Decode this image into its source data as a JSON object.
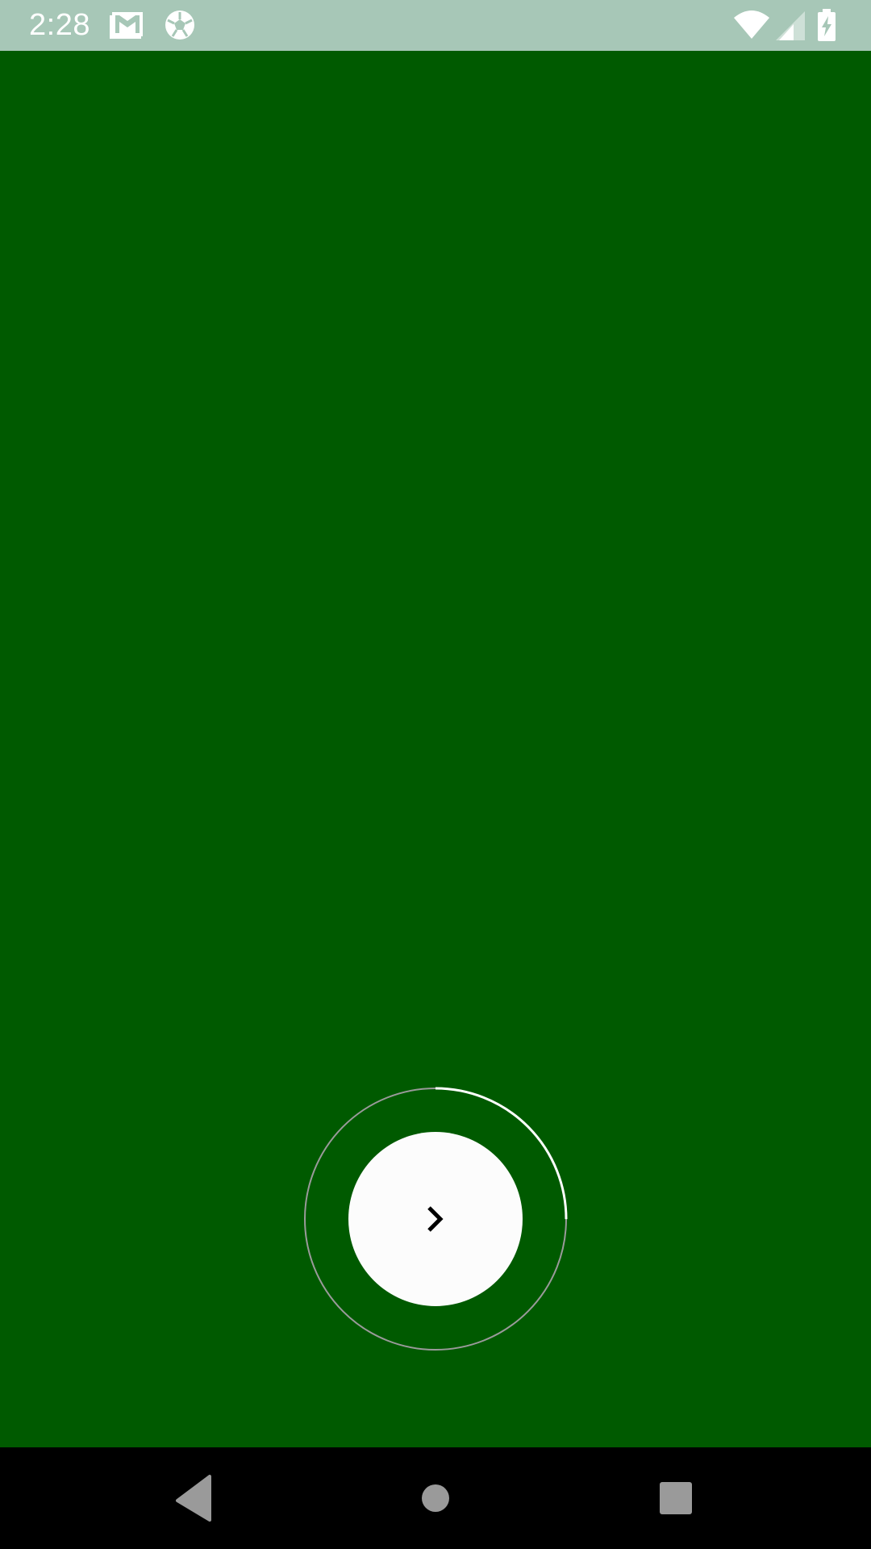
{
  "status_bar": {
    "time": "2:28",
    "icons": [
      "gmail-icon",
      "soccer-ball-icon",
      "wifi-icon",
      "cell-signal-icon",
      "battery-charging-icon"
    ]
  },
  "main": {
    "background_color": "#005a00",
    "next_control": {
      "icon": "chevron-right-icon",
      "progress_fraction": 0.25,
      "ring_track_color": "#9a9a9a",
      "ring_progress_color": "#ffffff",
      "button_color": "#fcfcfc"
    }
  },
  "nav_bar": {
    "buttons": [
      "back-icon",
      "home-icon",
      "recents-icon"
    ]
  }
}
